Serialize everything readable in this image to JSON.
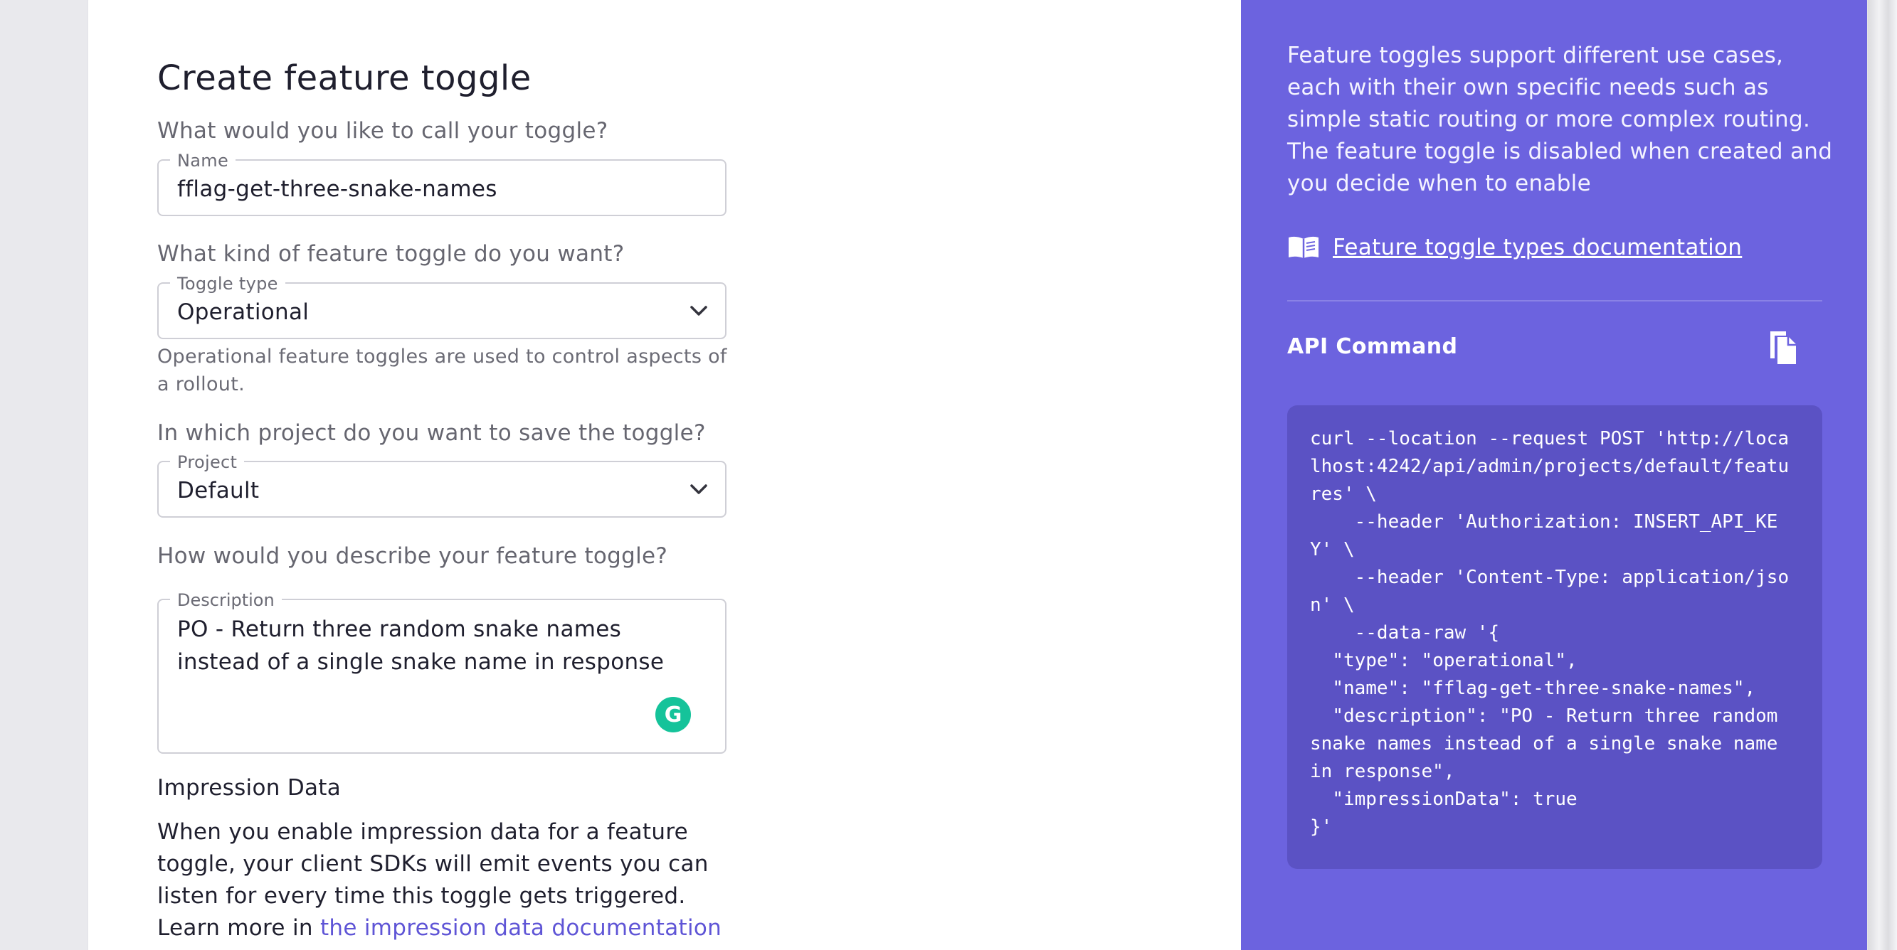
{
  "page": {
    "title": "Create feature toggle"
  },
  "form": {
    "name_question": "What would you like to call your toggle?",
    "name_legend": "Name",
    "name_value": "fflag-get-three-snake-names",
    "type_question": "What kind of feature toggle do you want?",
    "type_legend": "Toggle type",
    "type_value": "Operational",
    "type_helper": "Operational feature toggles are used to control aspects of a rollout.",
    "project_question": "In which project do you want to save the toggle?",
    "project_legend": "Project",
    "project_value": "Default",
    "desc_question": "How would you describe your feature toggle?",
    "desc_legend": "Description",
    "desc_value": "PO - Return three random snake names instead of a single snake name in response",
    "grammarly_letter": "G",
    "impression_title": "Impression Data",
    "impression_body": "When you enable impression data for a feature toggle, your client SDKs will emit events you can listen for every time this toggle gets triggered. Learn more in",
    "impression_link": "the impression data documentation"
  },
  "sidebar": {
    "description": "Feature toggles support different use cases, each with their own specific needs such as simple static routing or more complex routing. The feature toggle is disabled when created and you decide when to enable",
    "doc_link": "Feature toggle types documentation",
    "api_label": "API Command",
    "api_command": "curl --location --request POST 'http://localhost:4242/api/admin/projects/default/features' \\\n    --header 'Authorization: INSERT_API_KEY' \\\n    --header 'Content-Type: application/json' \\\n    --data-raw '{\n  \"type\": \"operational\",\n  \"name\": \"fflag-get-three-snake-names\",\n  \"description\": \"PO - Return three random snake names instead of a single snake name in response\",\n  \"impressionData\": true\n}'"
  },
  "colors": {
    "sidebar_bg": "#6c63df",
    "code_bg": "#5b52c4",
    "link": "#5f55d6",
    "grammarly": "#15c39a"
  },
  "icons": [
    "chevron-down-icon",
    "book-icon",
    "copy-icon",
    "grammarly-icon"
  ]
}
